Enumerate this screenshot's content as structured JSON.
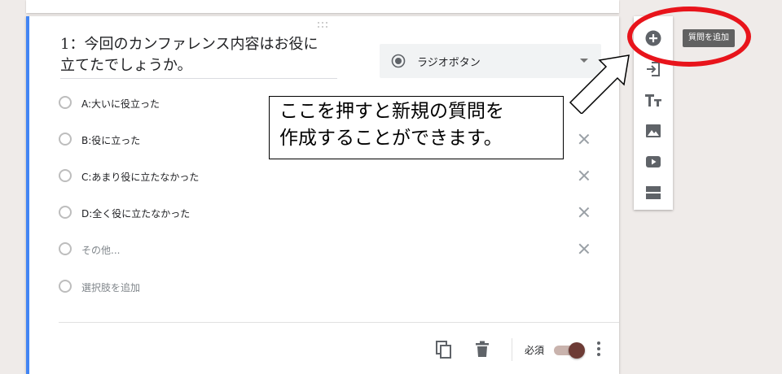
{
  "question": {
    "title_line1": "1：今回のカンファレンス内容はお役に",
    "title_line2": "立てたでしょうか。",
    "type_label": "ラジオボタン"
  },
  "options": [
    {
      "label": "A:大いに役立った",
      "muted": false,
      "removable": false
    },
    {
      "label": "B:役に立った",
      "muted": false,
      "removable": true
    },
    {
      "label": "C:あまり役に立たなかった",
      "muted": false,
      "removable": true
    },
    {
      "label": "D:全く役に立たなかった",
      "muted": false,
      "removable": true
    },
    {
      "label": "その他...",
      "muted": true,
      "removable": true
    },
    {
      "label": "選択肢を追加",
      "muted": true,
      "removable": false
    }
  ],
  "footer": {
    "required_label": "必須",
    "required_on": true
  },
  "side_toolbar": {
    "tooltip": "質問を追加",
    "tools": [
      "add-question-icon",
      "import-questions-icon",
      "add-title-icon",
      "add-image-icon",
      "add-video-icon",
      "add-section-icon"
    ]
  },
  "annotation": {
    "line1": "ここを押すと新規の質問を",
    "line2": "作成することができます。",
    "ring_color": "#e8141b"
  },
  "colors": {
    "accent": "#4285f4",
    "toggle_thumb": "#6d3b35",
    "background": "#efebe9"
  }
}
